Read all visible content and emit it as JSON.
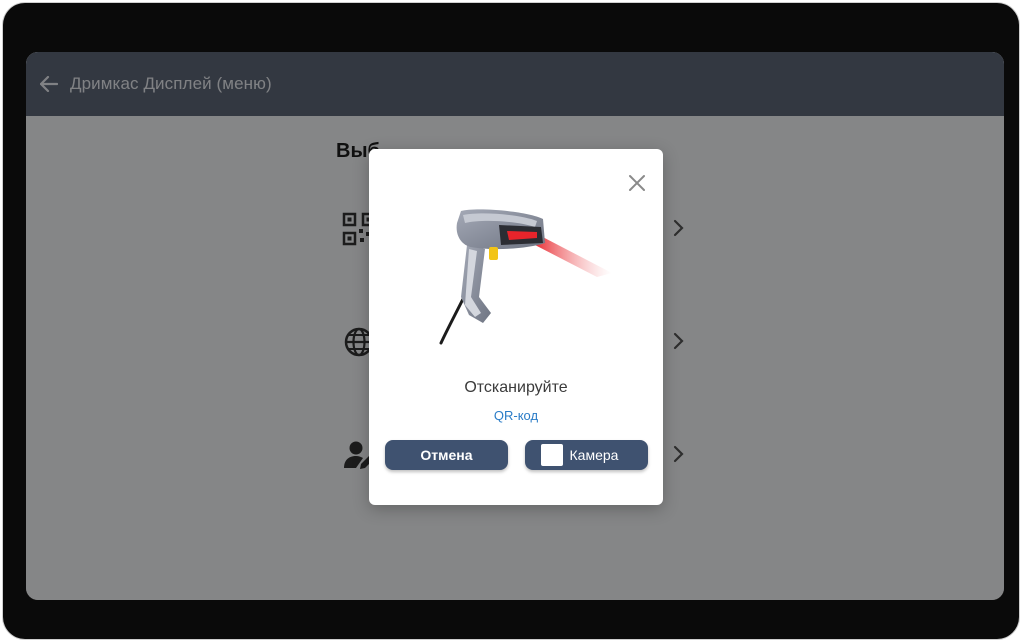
{
  "appbar": {
    "title": "Дримкас Дисплей (меню)",
    "back_icon": "arrow-left-icon"
  },
  "content": {
    "heading": "Выб",
    "options": [
      {
        "icon": "qr-code-icon",
        "label": ""
      },
      {
        "icon": "globe-icon",
        "label": ""
      },
      {
        "icon": "user-edit-icon",
        "label": ""
      }
    ]
  },
  "dialog": {
    "close_icon": "close-icon",
    "illustration": "barcode-scanner-icon",
    "title": "Отсканируйте",
    "subtitle": "QR-код",
    "cancel_label": "Отмена",
    "camera_label": "Камера"
  },
  "colors": {
    "appbar": "#5d6677",
    "button": "#3f5270",
    "link": "#2a7cc7",
    "laser": "#e8242b"
  }
}
